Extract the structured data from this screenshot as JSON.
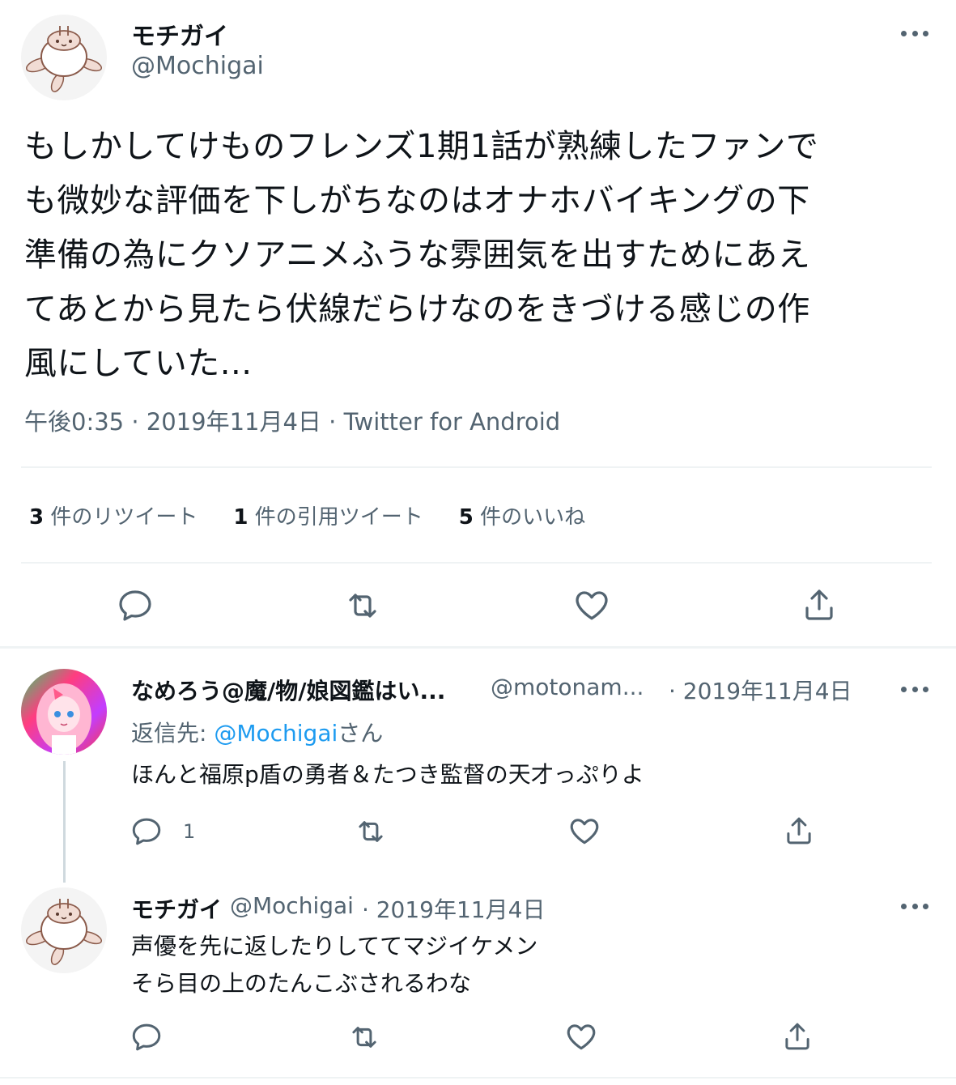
{
  "main_tweet": {
    "avatar_icon": "turtle-mochi-avatar",
    "display_name": "モチガイ",
    "handle": "@Mochigai",
    "text_lines": [
      "もしかしてけものフレンズ1期1話が熟練したファンで",
      "も微妙な評価を下しがちなのはオナホバイキングの下",
      "準備の為にクソアニメふうな雰囲気を出すためにあえ",
      "てあとから見たら伏線だらけなのをきづける感じの作",
      "風にしていた..."
    ],
    "meta": "午後0:35 · 2019年11月4日 · Twitter for Android",
    "stats": [
      {
        "count": "3",
        "label": "件のリツイート"
      },
      {
        "count": "1",
        "label": "件の引用ツイート"
      },
      {
        "count": "5",
        "label": "件のいいね"
      }
    ]
  },
  "replies": [
    {
      "avatar_icon": "pink-haired-girl-avatar",
      "display_name": "なめろう@魔/物/娘図鑑はい...",
      "handle": "@motonam...",
      "date": "· 2019年11月4日",
      "replying_prefix": "返信先: ",
      "replying_to": "@Mochigai",
      "replying_suffix": "さん",
      "text_lines": [
        "ほんと福原p盾の勇者＆たつき監督の天才っぷりよ"
      ],
      "reply_count": "1"
    },
    {
      "avatar_icon": "turtle-mochi-avatar",
      "display_name": "モチガイ",
      "handle": "@Mochigai",
      "date": "· 2019年11月4日",
      "text_lines": [
        "声優を先に返したりしててマジイケメン",
        "そら目の上のたんこぶされるわな"
      ],
      "reply_count": ""
    }
  ],
  "colors": {
    "text": "#0f1419",
    "secondary": "#536471",
    "link": "#1d9bf0",
    "divider": "#eff3f4",
    "thread_line": "#cfd9de"
  }
}
